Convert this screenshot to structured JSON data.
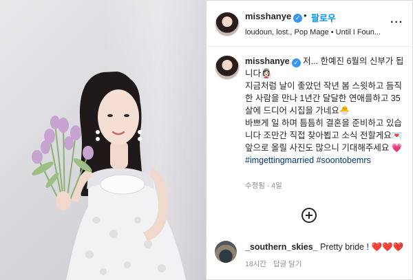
{
  "header": {
    "username": "misshanye",
    "follow_label": "팔로우",
    "separator": "•",
    "music": "loudoun, lost., Pop Mage • Until I Foun...",
    "more_label": "···"
  },
  "caption": {
    "username": "misshanye",
    "lines": [
      "저... 한예진 6월의 신부가 됩니다👰🏻‍♀️",
      "지금처럼 날이 좋았던 작년 봄 스윗하고 듬직한 사람을 만나 1년간 달달한 연애를하고 35살에 드디어 시집을 가네요🐣",
      "바쁘게 일 하며 틈틈히 결혼을 준비하고 있습니다 조만간 직접 찾아뵙고 소식 전할게요💌",
      "앞으로 올릴 사진도 많으니 기대해주세요 💗"
    ],
    "hashtags": "#imgettingmarried #soontobemrs",
    "meta": "수정됨 · 4일"
  },
  "comment": {
    "username": "_southern_skies_",
    "text": "Pretty bride ! ",
    "hearts": "❤️❤️❤️",
    "time": "18시간",
    "reply_label": "답글 달기"
  },
  "icons": {
    "verified": "verified-badge-icon",
    "add": "add-circle-icon",
    "like": "heart-icon"
  },
  "colors": {
    "accent": "#0095f6",
    "verified": "#3897f0",
    "hashtag": "#00376b",
    "meta": "#8e8e8e",
    "heart": "#ed4956"
  }
}
